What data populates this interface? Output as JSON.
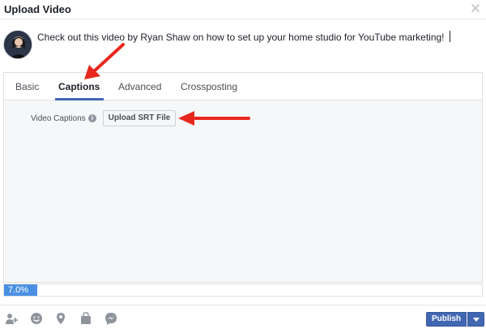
{
  "dialog": {
    "title": "Upload Video",
    "close_icon": "close-icon"
  },
  "composer": {
    "avatar_icon": "avatar",
    "text": "Check out this video by Ryan Shaw on how to set up your home studio for YouTube marketing!"
  },
  "tabs": [
    {
      "label": "Basic",
      "active": false
    },
    {
      "label": "Captions",
      "active": true
    },
    {
      "label": "Advanced",
      "active": false
    },
    {
      "label": "Crossposting",
      "active": false
    }
  ],
  "captions": {
    "label": "Video Captions",
    "info_icon": "info-icon",
    "upload_button": "Upload SRT File"
  },
  "progress": {
    "label": "7.0%",
    "percent": 7.0
  },
  "footer": {
    "icons": [
      "tag-people-icon",
      "feeling-icon",
      "location-icon",
      "shopping-bag-icon",
      "messenger-icon"
    ],
    "publish_label": "Publish"
  },
  "colors": {
    "brand": "#4267b2",
    "progress": "#4a90e2",
    "annotation_arrow": "#e8281e"
  }
}
